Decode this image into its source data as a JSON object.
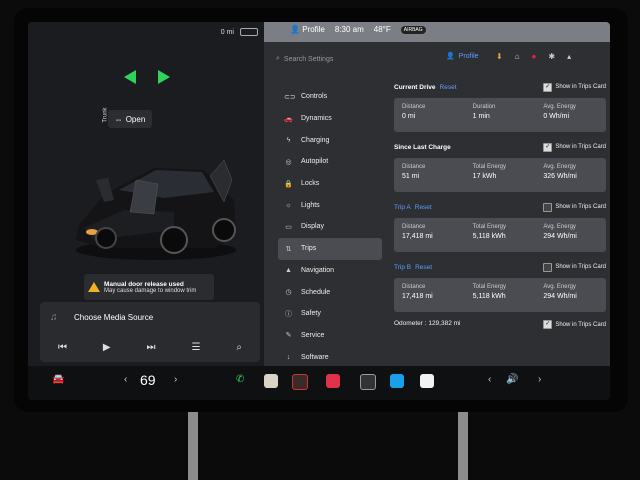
{
  "status_left": {
    "range": "0 mi"
  },
  "top_status": {
    "profile": "Profile",
    "time": "8:30 am",
    "temp": "48°F",
    "airbag": "AIRBAG"
  },
  "car": {
    "trunk_label": "Trunk",
    "open_label": "Open",
    "warning_title": "Manual door release used",
    "warning_sub": "May cause damage to window trim"
  },
  "media": {
    "source_label": "Choose Media Source"
  },
  "settings": {
    "search_placeholder": "Search Settings",
    "profile_label": "Profile",
    "menu": [
      {
        "label": "Controls",
        "icon": "toggle-icon"
      },
      {
        "label": "Dynamics",
        "icon": "car-icon"
      },
      {
        "label": "Charging",
        "icon": "bolt-icon"
      },
      {
        "label": "Autopilot",
        "icon": "steering-icon"
      },
      {
        "label": "Locks",
        "icon": "lock-icon"
      },
      {
        "label": "Lights",
        "icon": "light-icon"
      },
      {
        "label": "Display",
        "icon": "display-icon"
      },
      {
        "label": "Trips",
        "icon": "trips-icon"
      },
      {
        "label": "Navigation",
        "icon": "navigation-icon"
      },
      {
        "label": "Schedule",
        "icon": "clock-icon"
      },
      {
        "label": "Safety",
        "icon": "safety-icon"
      },
      {
        "label": "Service",
        "icon": "wrench-icon"
      },
      {
        "label": "Software",
        "icon": "download-icon"
      }
    ]
  },
  "trips": {
    "show_label": "Show in Trips Card",
    "reset_label": "Reset",
    "current": {
      "title": "Current Drive",
      "distance_label": "Distance",
      "distance": "0 mi",
      "duration_label": "Duration",
      "duration": "1 min",
      "energy_label": "Avg. Energy",
      "energy": "0 Wh/mi"
    },
    "since_charge": {
      "title": "Since Last Charge",
      "distance_label": "Distance",
      "distance": "51 mi",
      "total_label": "Total Energy",
      "total": "17 kWh",
      "energy_label": "Avg. Energy",
      "energy": "326 Wh/mi"
    },
    "trip_a": {
      "title": "Trip A",
      "distance_label": "Distance",
      "distance": "17,418 mi",
      "total_label": "Total Energy",
      "total": "5,118 kWh",
      "energy_label": "Avg. Energy",
      "energy": "294 Wh/mi"
    },
    "trip_b": {
      "title": "Trip B",
      "distance_label": "Distance",
      "distance": "17,418 mi",
      "total_label": "Total Energy",
      "total": "5,118 kWh",
      "energy_label": "Avg. Energy",
      "energy": "294 Wh/mi"
    },
    "odometer_label": "Odometer :",
    "odometer": "129,382 mi"
  },
  "dock": {
    "temperature": "69"
  },
  "colors": {
    "accent": "#5d9cff",
    "green": "#2fd35a",
    "warning": "#f0b323"
  }
}
